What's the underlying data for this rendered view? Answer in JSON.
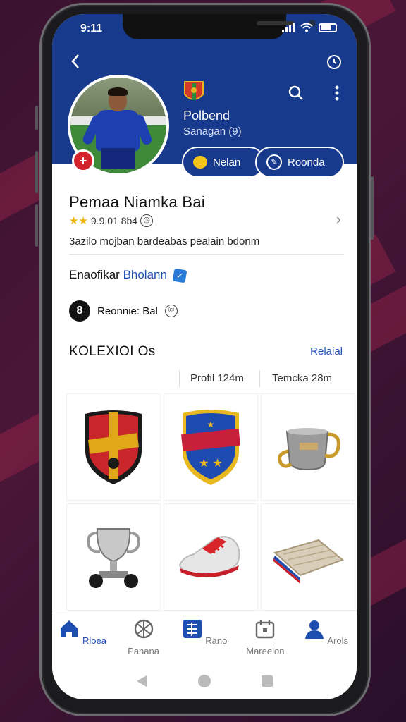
{
  "status": {
    "time": "9:11"
  },
  "header": {
    "club_name": "Polbend",
    "club_sub": "Sanagan (9)",
    "pill_follow": "Nelan",
    "pill_record": "Roonda"
  },
  "profile": {
    "name": "Pemaa  Niamka  Bai",
    "rating": "9.9.01 8b4",
    "description": "3azilo mojban bardeabas pealain bdonm",
    "verified_prefix": "Enaofikar",
    "verified_link": "Bholann",
    "position": "Reonnie: Bal"
  },
  "collection": {
    "title": "KOLEXIOI Os",
    "link": "Relaial",
    "col1": "Profil 124m",
    "col2": "Temcka 28m",
    "items": [
      "club-shield-badge",
      "star-shield-badge",
      "silver-cup",
      "trophy-cup",
      "red-sneaker",
      "folded-jersey"
    ]
  },
  "tabs": [
    {
      "label": "Rloea",
      "icon": "home-icon"
    },
    {
      "label": "Panana",
      "icon": "ball-icon"
    },
    {
      "label": "Rano",
      "icon": "grid-icon"
    },
    {
      "label": "Mareelon",
      "icon": "calendar-icon"
    },
    {
      "label": "Arols",
      "icon": "person-icon"
    }
  ],
  "colors": {
    "header": "#173a8c",
    "accent": "#1d4fb0",
    "badge_red": "#d3232d",
    "star": "#f0b400"
  }
}
